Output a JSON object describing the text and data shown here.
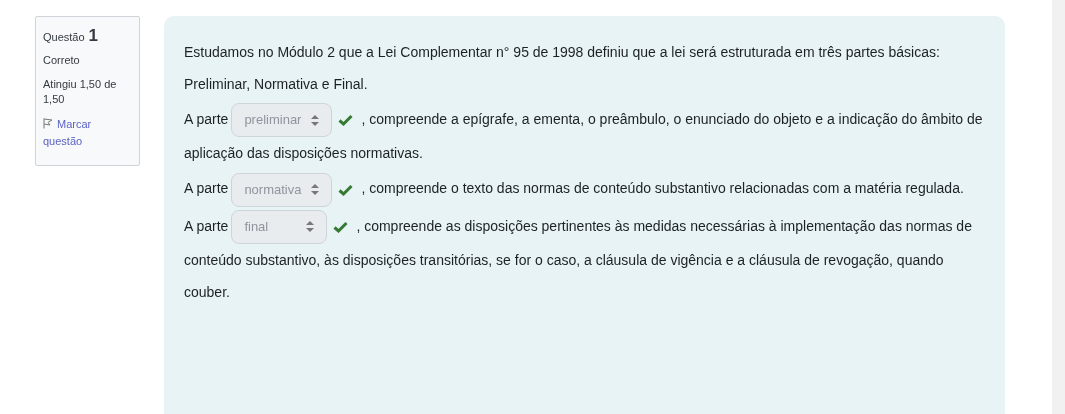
{
  "question": {
    "label": "Questão",
    "number": "1",
    "status": "Correto",
    "grade": "Atingiu 1,50 de 1,50",
    "flag": "Marcar questão"
  },
  "intro": "Estudamos no Módulo 2 que a Lei Complementar n° 95 de 1998 definiu que a lei será estruturada em três partes básicas: Preliminar, Normativa e Final.",
  "parts": [
    {
      "prefix": "A parte",
      "answer": "preliminar",
      "disabled": true,
      "correct": true,
      "suffix": ", compreende a epígrafe, a ementa, o preâmbulo, o enunciado do objeto e a indicação do âmbito de aplicação das disposições normativas."
    },
    {
      "prefix": "A parte",
      "answer": "normativa",
      "disabled": true,
      "correct": true,
      "suffix": ", compreende o texto das normas de conteúdo substantivo relacionadas com a matéria regulada."
    },
    {
      "prefix": "A parte",
      "answer": "final",
      "disabled": true,
      "correct": true,
      "suffix": ", compreende as disposições pertinentes às medidas necessárias à implementação das normas de conteúdo substantivo, às disposições transitórias, se for o caso, a cláusula de vigência e a cláusula de revogação, quando couber."
    }
  ]
}
